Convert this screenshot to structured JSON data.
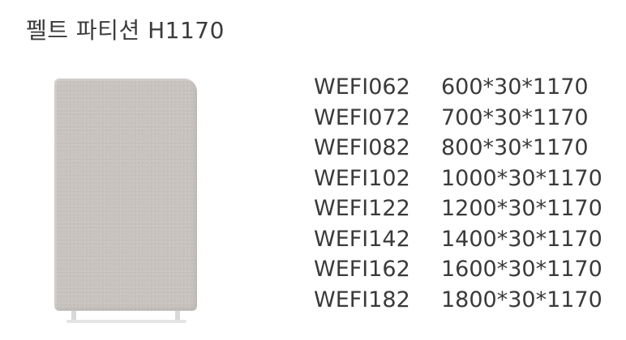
{
  "title": "펠트 파티션 H1170",
  "product_image": {
    "icon": "felt-partition-panel-image",
    "color": "#c8c3bf"
  },
  "specs": [
    {
      "code": "WEFI062",
      "size": "600*30*1170"
    },
    {
      "code": "WEFI072",
      "size": "700*30*1170"
    },
    {
      "code": "WEFI082",
      "size": "800*30*1170"
    },
    {
      "code": "WEFI102",
      "size": "1000*30*1170"
    },
    {
      "code": "WEFI122",
      "size": "1200*30*1170"
    },
    {
      "code": "WEFI142",
      "size": "1400*30*1170"
    },
    {
      "code": "WEFI162",
      "size": "1600*30*1170"
    },
    {
      "code": "WEFI182",
      "size": "1800*30*1170"
    }
  ]
}
